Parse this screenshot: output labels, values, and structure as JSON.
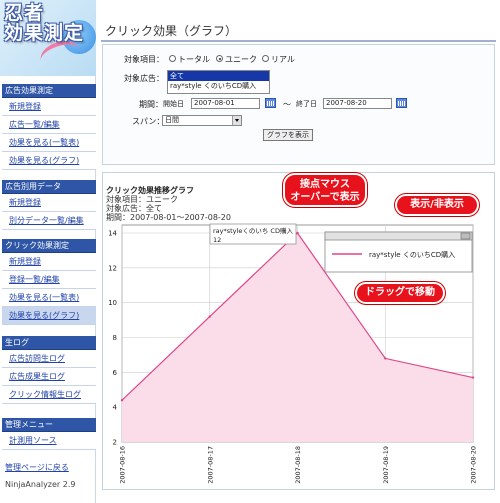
{
  "logo": {
    "line1": "忍者",
    "line2": "効果測定"
  },
  "sidebar": {
    "sections": [
      {
        "title": "広告効果測定",
        "items": [
          "新規登録",
          "広告一覧/編集",
          "効果を見る(一覧表)",
          "効果を見る(グラフ)"
        ]
      },
      {
        "title": "広告別用データ",
        "items": [
          "新規登録",
          "別分データ一覧/編集"
        ]
      },
      {
        "title": "クリック効果測定",
        "items": [
          "新規登録",
          "登録一覧/編集",
          "効果を見る(一覧表)",
          "効果を見る(グラフ)"
        ]
      },
      {
        "title": "生ログ",
        "items": [
          "広告訪問生ログ",
          "広告成果生ログ",
          "クリック情報生ログ"
        ]
      },
      {
        "title": "管理メニュー",
        "items": [
          "計測用ソース"
        ]
      }
    ],
    "back_link": "管理ページに戻る",
    "version": "NinjaAnalyzer 2.9"
  },
  "main": {
    "title": "クリック効果（グラフ）",
    "form": {
      "target_item_label": "対象項目：",
      "radios": [
        "トータル",
        "ユニーク",
        "リアル"
      ],
      "selected_radio": "ユニーク",
      "target_ad_label": "対象広告：",
      "ad_options": [
        "全て",
        "ray*style くのいちCD購入"
      ],
      "selected_ad": "全て",
      "period_label": "期間：",
      "start_label": "開始日",
      "start_value": "2007-08-01",
      "range_sep": "〜",
      "end_label": "終了日",
      "end_value": "2007-08-20",
      "span_label": "スパン：",
      "span_value": "日間",
      "submit_label": "グラフを表示"
    },
    "graph": {
      "heading": "クリック効果推移グラフ",
      "item_line": "対象項目：ユニーク",
      "ad_line": "対象広告：全て",
      "period_line": "期間：2007-08-01〜2007-08-20"
    },
    "tooltip": {
      "label": "ray*styleくのいち CD購入",
      "value": "12"
    },
    "legend": {
      "entry": "ray*style くのいちCD購入"
    },
    "callouts": {
      "hover": [
        "接点マウス",
        "オーバーで表示"
      ],
      "toggle": "表示/非表示",
      "drag": "ドラッグで移動"
    }
  },
  "colors": {
    "accent": "#2f56a6",
    "series_line": "#e0458a",
    "series_fill": "#fbdde9",
    "callout": "#e8121c"
  },
  "chart_data": {
    "type": "area",
    "x": [
      "2007-08-16",
      "2007-08-17",
      "2007-08-18",
      "2007-08-19",
      "2007-08-20"
    ],
    "series": [
      {
        "name": "ray*style くのいちCD購入",
        "values": [
          4.4,
          9.2,
          14,
          6.8,
          5.7
        ]
      }
    ],
    "ylim": [
      2,
      14
    ],
    "yticks": [
      2,
      4,
      6,
      8,
      10,
      12,
      14
    ],
    "grid": true,
    "legend": "top-right"
  }
}
